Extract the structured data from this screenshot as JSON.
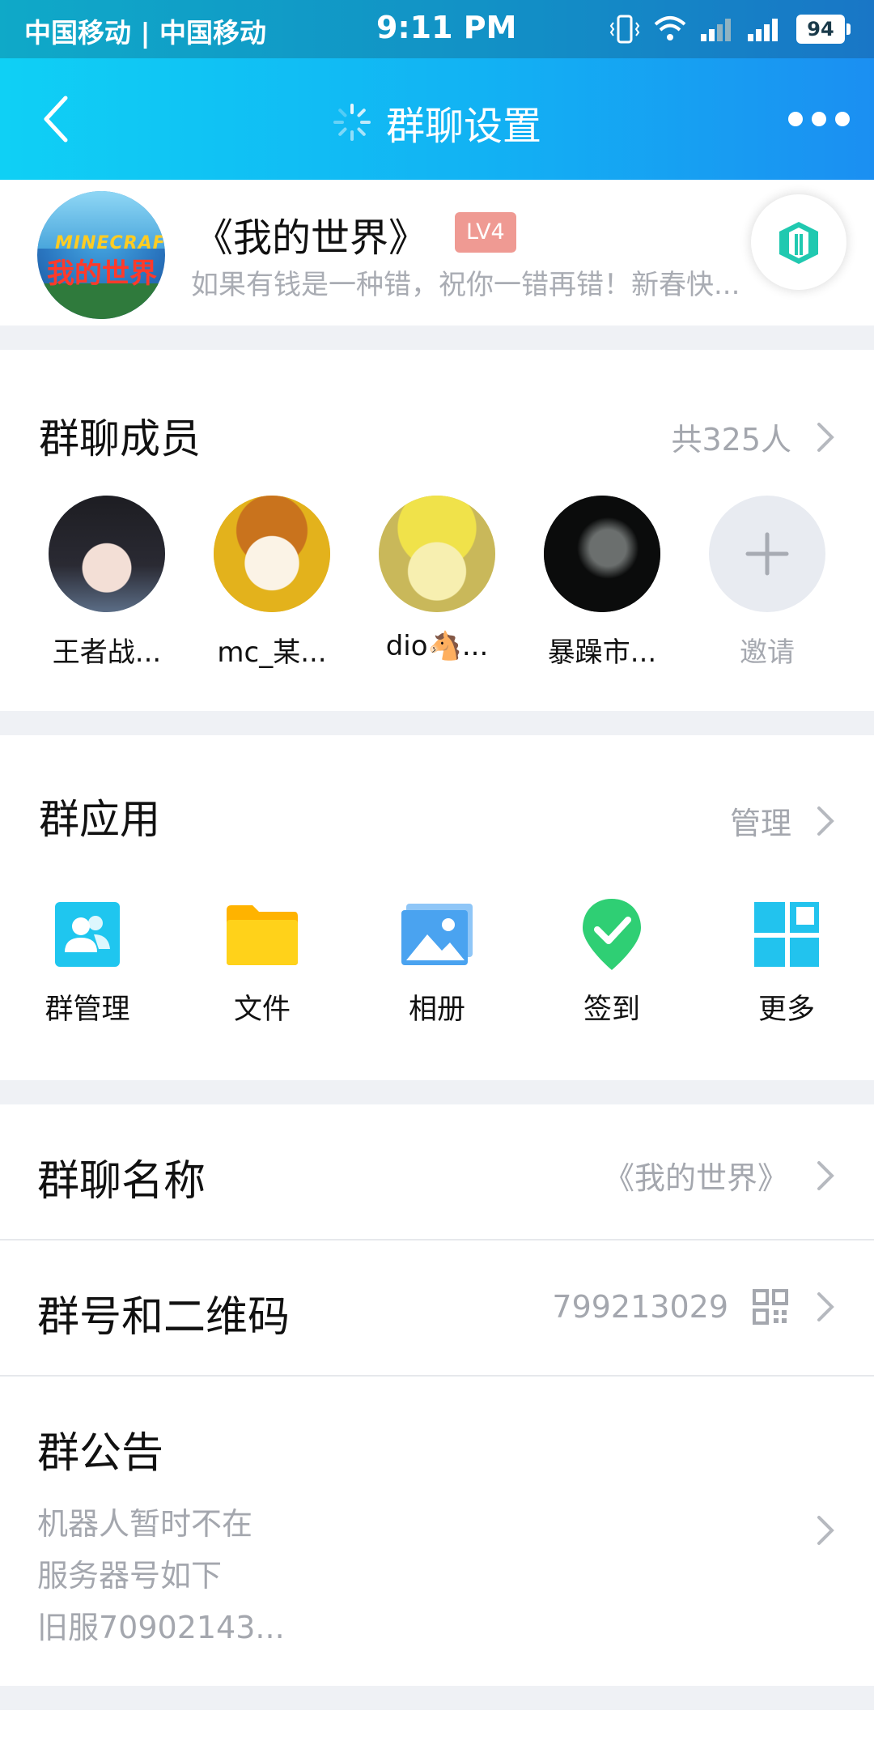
{
  "status_bar": {
    "carrier": "中国移动 | 中国移动",
    "time": "9:11 PM",
    "battery": "94"
  },
  "nav": {
    "title": "群聊设置"
  },
  "group": {
    "name": "《我的世界》",
    "level": "LV4",
    "motto": "如果有钱是一种错，祝你一错再错！新春快...",
    "avatar_text_top": "MINECRAFT",
    "avatar_text_main": "我的世界"
  },
  "members_section": {
    "title": "群聊成员",
    "count": "共325人",
    "members": [
      {
        "name": "王者战..."
      },
      {
        "name": "mc_某..."
      },
      {
        "name": "dio🐴..."
      },
      {
        "name": "暴躁市..."
      }
    ],
    "invite_label": "邀请"
  },
  "apps_section": {
    "title": "群应用",
    "manage": "管理",
    "apps": [
      {
        "label": "群管理",
        "icon": "group-manage-icon",
        "color": "#1fc6ef"
      },
      {
        "label": "文件",
        "icon": "folder-icon",
        "color": "#ffc107"
      },
      {
        "label": "相册",
        "icon": "album-icon",
        "color": "#4aa3f0"
      },
      {
        "label": "签到",
        "icon": "checkin-icon",
        "color": "#2fcf74"
      },
      {
        "label": "更多",
        "icon": "more-apps-icon",
        "color": "#22c3ee"
      }
    ]
  },
  "settings": {
    "group_name_label": "群聊名称",
    "group_name_value": "《我的世界》",
    "group_id_label": "群号和二维码",
    "group_id_value": "799213029",
    "notice_label": "群公告",
    "notice_lines": [
      "机器人暂时不在",
      "服务器号如下",
      "旧服70902143..."
    ]
  },
  "colors": {
    "accent": "#12b2f3",
    "badge": "#ef9a93",
    "muted_text": "#a4a7ae",
    "page_bg": "#eff1f5"
  }
}
